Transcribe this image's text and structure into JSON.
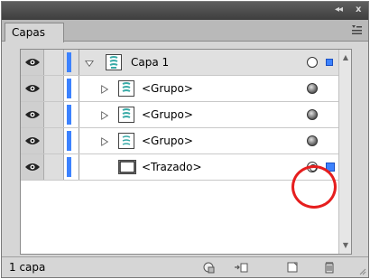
{
  "panel": {
    "title_controls": {
      "collapse": "◂◂",
      "close": "x"
    },
    "tab": {
      "label": "Capas"
    }
  },
  "layers": [
    {
      "label": "Capa 1",
      "kind": "layer",
      "expanded": true,
      "selected": true,
      "target": "hollow",
      "thumb": "group-thumb"
    },
    {
      "label": "<Grupo>",
      "kind": "group",
      "expanded": false,
      "target": "filled",
      "thumb": "group-thumb"
    },
    {
      "label": "<Grupo>",
      "kind": "group",
      "expanded": false,
      "target": "filled",
      "thumb": "group-thumb"
    },
    {
      "label": "<Grupo>",
      "kind": "group",
      "expanded": false,
      "target": "filled",
      "thumb": "group-thumb"
    },
    {
      "label": "<Trazado>",
      "kind": "path",
      "expanded": false,
      "target": "double",
      "selected_art": true,
      "thumb": "rect-thumb"
    }
  ],
  "footer": {
    "count": "1 capa"
  },
  "colors": {
    "layer_color": "#3c82ff",
    "highlight": "#e61e1e"
  }
}
